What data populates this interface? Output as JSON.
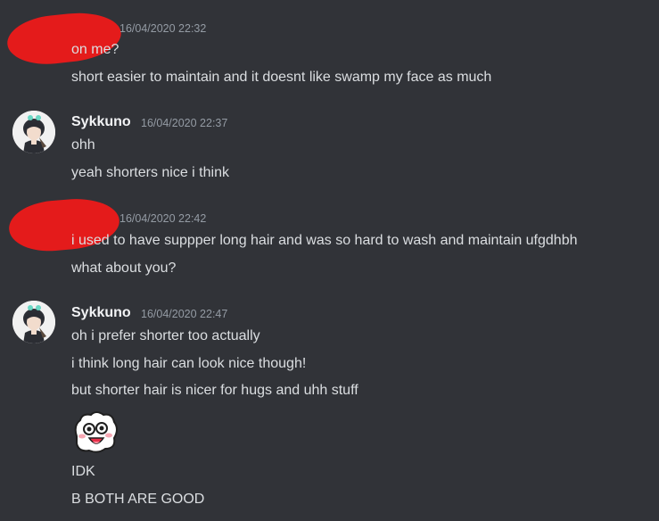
{
  "colors": {
    "background": "#313338",
    "text": "#dbdee1",
    "username": "#f2f3f5",
    "timestamp": "#949ba4",
    "redaction": "#e41b1b"
  },
  "messages": [
    {
      "author": "",
      "author_redacted": true,
      "timestamp": "16/04/2020 22:32",
      "lines": [
        "on me?",
        "short easier to maintain and it doesnt like swamp my face as much"
      ]
    },
    {
      "author": "Sykkuno",
      "avatar_icon": "anime-avatar-icon",
      "timestamp": "16/04/2020 22:37",
      "lines": [
        "ohh",
        "yeah shorters nice i think"
      ]
    },
    {
      "author": "",
      "author_redacted": true,
      "timestamp": "16/04/2020 22:42",
      "lines": [
        "i used to have suppper long hair and was so hard to wash and maintain ufgdhbh",
        "what about you?"
      ]
    },
    {
      "author": "Sykkuno",
      "avatar_icon": "anime-avatar-icon",
      "timestamp": "16/04/2020 22:47",
      "lines": [
        "oh i prefer shorter too actually",
        "i think long hair can look nice though!",
        "but shorter hair is nicer for hugs and uhh stuff",
        "IDK",
        "B BOTH ARE GOOD"
      ],
      "emoji_icon": "blushing-blob-emoji-icon"
    }
  ]
}
